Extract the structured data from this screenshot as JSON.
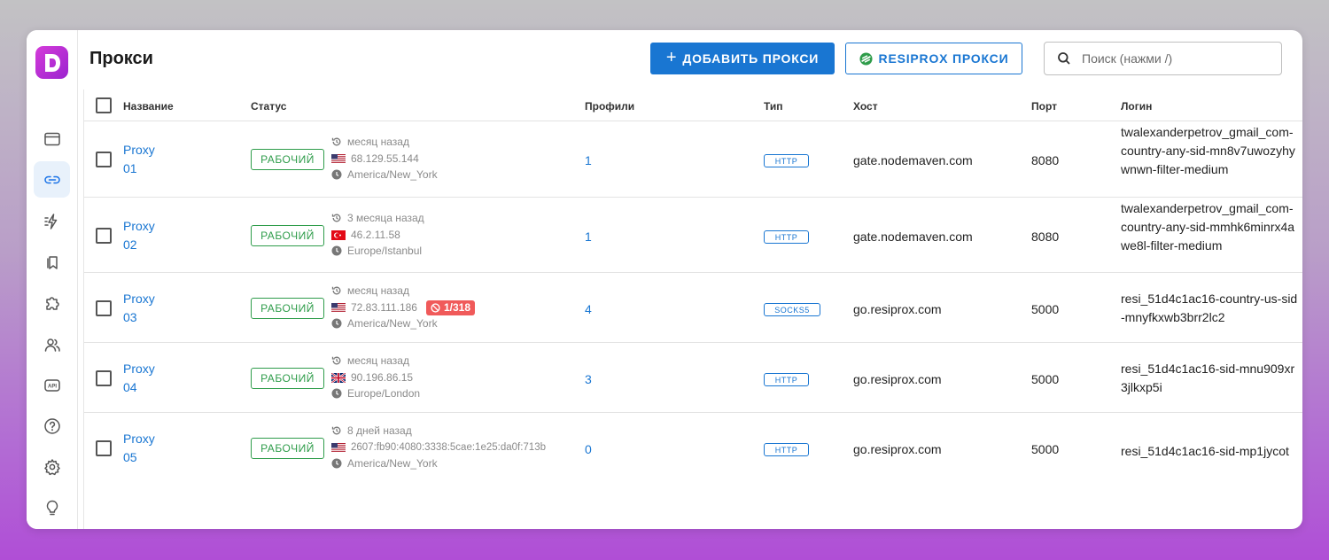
{
  "app": {
    "title": "Прокси"
  },
  "colors": {
    "accent": "#1976d2",
    "status_ok": "#2e9c4a",
    "error": "#f05a5a",
    "logo": "#c52fd7"
  },
  "sidebar": {
    "items": [
      {
        "name": "browser-icon",
        "active": false
      },
      {
        "name": "link-icon",
        "active": true
      },
      {
        "name": "automation-icon",
        "active": false
      },
      {
        "name": "bookmarks-icon",
        "active": false
      },
      {
        "name": "extensions-icon",
        "active": false
      },
      {
        "name": "users-icon",
        "active": false
      },
      {
        "name": "api-icon",
        "active": false
      },
      {
        "name": "help-icon",
        "active": false
      },
      {
        "name": "settings-icon",
        "active": false
      },
      {
        "name": "lightbulb-icon",
        "active": false
      }
    ]
  },
  "toolbar": {
    "add_label": "ДОБАВИТЬ ПРОКСИ",
    "resiprox_label": "RESIPROX ПРОКСИ",
    "search_placeholder": "Поиск (нажми /)"
  },
  "table": {
    "headers": {
      "name": "Название",
      "status": "Статус",
      "profiles": "Профили",
      "type": "Тип",
      "host": "Хост",
      "port": "Порт",
      "login": "Логин"
    },
    "rows": [
      {
        "name_line1": "Proxy",
        "name_line2": "01",
        "status": "РАБОЧИЙ",
        "checked": "месяц назад",
        "flag": "us",
        "ip": "68.129.55.144",
        "timezone": "America/New_York",
        "error": "",
        "profiles": "1",
        "type": "HTTP",
        "host": "gate.nodemaven.com",
        "port": "8080",
        "login": "twalexanderpetrov_gmail_com-country-any-sid-mn8v7uwozyhywnwn-filter-medium"
      },
      {
        "name_line1": "Proxy",
        "name_line2": "02",
        "status": "РАБОЧИЙ",
        "checked": "3 месяца назад",
        "flag": "tr",
        "ip": "46.2.11.58",
        "timezone": "Europe/Istanbul",
        "error": "",
        "profiles": "1",
        "type": "HTTP",
        "host": "gate.nodemaven.com",
        "port": "8080",
        "login": "twalexanderpetrov_gmail_com-country-any-sid-mmhk6minrx4awe8l-filter-medium"
      },
      {
        "name_line1": "Proxy",
        "name_line2": "03",
        "status": "РАБОЧИЙ",
        "checked": "месяц назад",
        "flag": "us",
        "ip": "72.83.111.186",
        "timezone": "America/New_York",
        "error": "1/318",
        "profiles": "4",
        "type": "SOCKS5",
        "host": "go.resiprox.com",
        "port": "5000",
        "login": "resi_51d4c1ac16-country-us-sid-mnyfkxwb3brr2lc2"
      },
      {
        "name_line1": "Proxy",
        "name_line2": "04",
        "status": "РАБОЧИЙ",
        "checked": "месяц назад",
        "flag": "gb",
        "ip": "90.196.86.15",
        "timezone": "Europe/London",
        "error": "",
        "profiles": "3",
        "type": "HTTP",
        "host": "go.resiprox.com",
        "port": "5000",
        "login": "resi_51d4c1ac16-sid-mnu909xr3jlkxp5i"
      },
      {
        "name_line1": "Proxy",
        "name_line2": "05",
        "status": "РАБОЧИЙ",
        "checked": "8 дней назад",
        "flag": "us",
        "ip": "2607:fb90:4080:3338:5cae:1e25:da0f:713b",
        "timezone": "America/New_York",
        "error": "",
        "profiles": "0",
        "type": "HTTP",
        "host": "go.resiprox.com",
        "port": "5000",
        "login": "resi_51d4c1ac16-sid-mp1jycot"
      }
    ]
  }
}
